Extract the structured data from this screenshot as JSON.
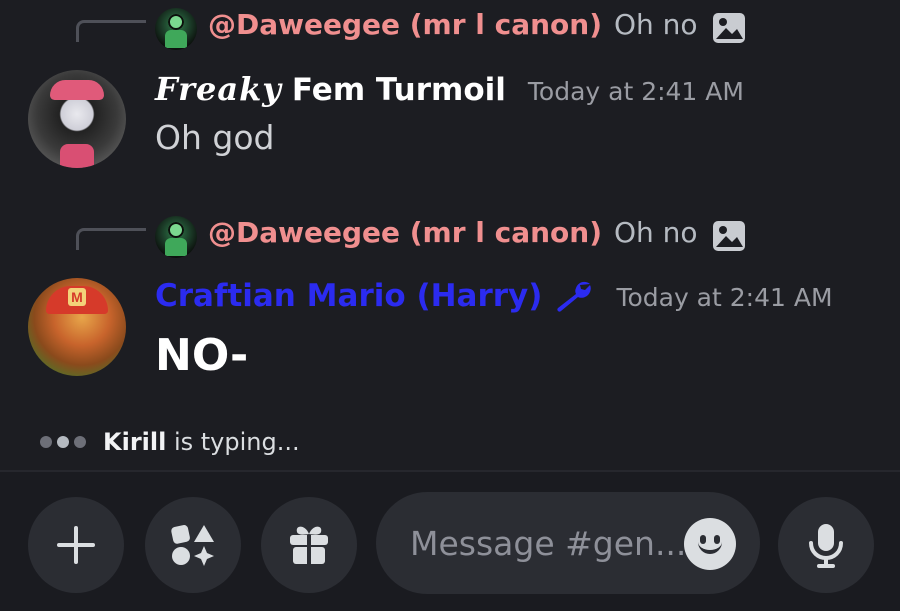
{
  "replies": [
    {
      "name": "@Daweegee (mr l canon)",
      "text": "Oh no",
      "attachment_icon": "image-icon"
    },
    {
      "name": "@Daweegee (mr l canon)",
      "text": "Oh no",
      "attachment_icon": "image-icon"
    }
  ],
  "messages": [
    {
      "author_fancy": "Freaky",
      "author_plain": "Fem Turmoil",
      "timestamp": "Today at 2:41 AM",
      "body": "Oh god"
    },
    {
      "author": "Craftian Mario (Harry)",
      "author_color": "#2b2bf0",
      "badge_icon": "wrench-icon",
      "timestamp": "Today at 2:41 AM",
      "body": "NO-"
    }
  ],
  "typing": {
    "user": "Kirill",
    "suffix": " is typing..."
  },
  "composer": {
    "placeholder": "Message #gen...",
    "buttons": [
      "plus-icon",
      "apps-icon",
      "gift-icon",
      "emoji-icon",
      "microphone-icon"
    ]
  },
  "colors": {
    "background": "#1c1d22",
    "reply_name": "#f08f8f",
    "mention_blue": "#2b2bf0",
    "button_bg": "#2b2d33"
  }
}
